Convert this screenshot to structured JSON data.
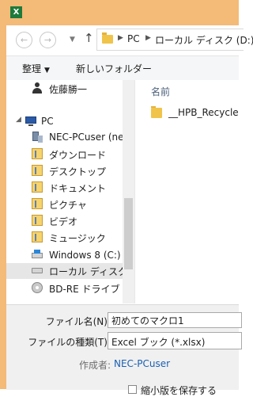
{
  "window": {
    "app_icon": "excel-icon",
    "app_icon_glyph": "X"
  },
  "navigation": {
    "back_icon": "back-arrow-icon",
    "forward_icon": "forward-arrow-icon",
    "up_icon": "up-arrow-icon",
    "address": [
      "PC",
      "ローカル ディスク (D:)"
    ]
  },
  "toolbar": {
    "organize_label": "整理",
    "new_folder_label": "新しいフォルダー"
  },
  "nav_tree": [
    {
      "label": "佐藤勝一",
      "icon": "user-folder-icon"
    },
    {
      "label": "PC",
      "icon": "computer-icon"
    },
    {
      "label": "NEC-PCuser (ne",
      "icon": "network-user-icon"
    },
    {
      "label": "ダウンロード",
      "icon": "downloads-folder-icon"
    },
    {
      "label": "デスクトップ",
      "icon": "desktop-folder-icon"
    },
    {
      "label": "ドキュメント",
      "icon": "documents-folder-icon"
    },
    {
      "label": "ピクチャ",
      "icon": "pictures-folder-icon"
    },
    {
      "label": "ビデオ",
      "icon": "videos-folder-icon"
    },
    {
      "label": "ミュージック",
      "icon": "music-folder-icon"
    },
    {
      "label": "Windows 8 (C:)",
      "icon": "windows-drive-icon"
    },
    {
      "label": "ローカル ディスク (D:",
      "icon": "local-disk-icon",
      "selected": true
    },
    {
      "label": "BD-RE ドライブ (E",
      "icon": "disc-drive-icon"
    }
  ],
  "content": {
    "column_header": "名前",
    "files": [
      {
        "name": "__HPB_Recycle",
        "icon": "folder-icon"
      }
    ]
  },
  "form": {
    "filename_label": "ファイル名(N):",
    "filename_value": "初めてのマクロ1",
    "filetype_label": "ファイルの種類(T):",
    "filetype_value": "Excel ブック (*.xlsx)",
    "author_label": "作成者:",
    "author_value": "NEC-PCuser",
    "thumbnail_label": "縮小版を保存する"
  },
  "colors": {
    "title_bar": "#f3ba78",
    "selected_item": "#e6e6e6",
    "link": "#1a5fb4"
  }
}
